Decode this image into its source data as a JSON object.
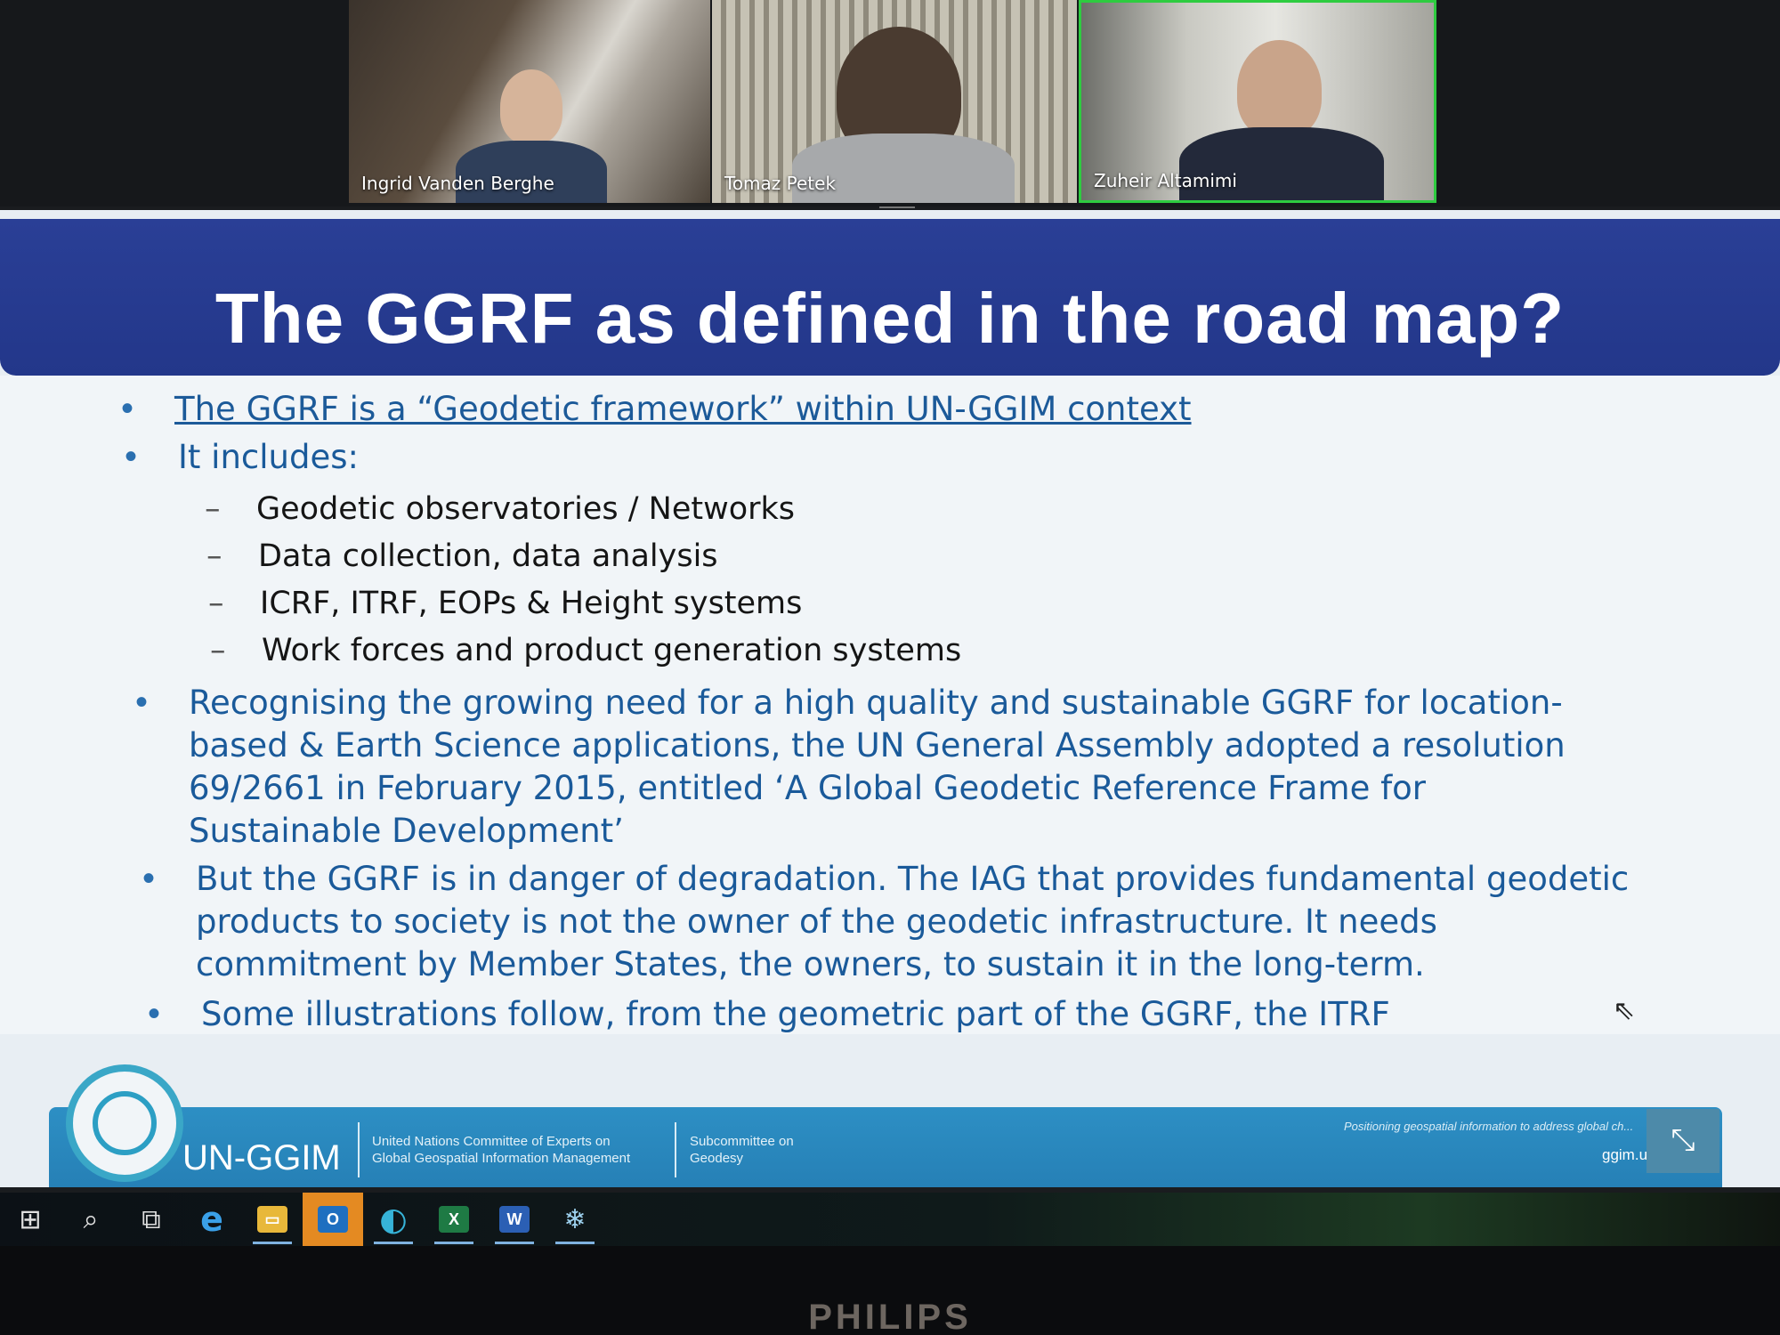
{
  "meeting": {
    "participants": [
      {
        "name": "Ingrid Vanden Berghe",
        "active": false
      },
      {
        "name": "Tomaz Petek",
        "active": false
      },
      {
        "name": "Zuheir Altamimi",
        "active": true
      }
    ]
  },
  "slide": {
    "title": "The GGRF as defined in the road map?",
    "bullets": [
      {
        "text": "The GGRF is a “Geodetic framework” within UN-GGIM context",
        "style": "link"
      },
      {
        "text": "It includes:",
        "style": "plain"
      }
    ],
    "sub_bullets": [
      "Geodetic observatories / Networks",
      "Data collection, data analysis",
      "ICRF, ITRF, EOPs & Height systems",
      "Work forces and product generation systems"
    ],
    "paragraphs": [
      {
        "lines": [
          "Recognising the growing need for a high quality and sustainable GGRF for location-",
          "based & Earth Science applications, the UN General Assembly adopted a resolution",
          "69/2661 in February 2015, entitled ‘A Global Geodetic Reference Frame for",
          "Sustainable Development’"
        ]
      },
      {
        "lines": [
          "But the GGRF is in danger of degradation. The IAG that provides fundamental geodetic",
          "products to society is not the owner of the geodetic infrastructure. It needs",
          "commitment by Member States, the owners, to sustain it in the long-term."
        ]
      },
      {
        "lines": [
          "Some illustrations follow, from the geometric part of the GGRF, the ITRF"
        ]
      }
    ],
    "footer": {
      "logo_text": "UN-GGIM",
      "committee_line1": "United Nations Committee of Experts on",
      "committee_line2": "Global Geospatial Information Management",
      "sub_line1": "Subcommittee on",
      "sub_line2": "Geodesy",
      "tagline": "Positioning geospatial information to address global ch...",
      "url": "ggim.un..."
    },
    "colors": {
      "header": "#23378a",
      "footer": "#2680b6",
      "text_blue": "#1a5a9a"
    }
  },
  "taskbar": {
    "items": [
      {
        "icon": "windows-start-icon",
        "glyph": "⊞"
      },
      {
        "icon": "search-icon",
        "glyph": "⌕"
      },
      {
        "icon": "task-view-icon",
        "glyph": "⧉"
      },
      {
        "icon": "internet-explorer-icon",
        "glyph": "e"
      },
      {
        "icon": "file-explorer-icon",
        "glyph": "▭"
      },
      {
        "icon": "outlook-icon",
        "glyph": "O"
      },
      {
        "icon": "edge-icon",
        "glyph": "◐"
      },
      {
        "icon": "excel-icon",
        "glyph": "X"
      },
      {
        "icon": "word-icon",
        "glyph": "W"
      },
      {
        "icon": "zoom-app-icon",
        "glyph": "❄"
      }
    ]
  },
  "monitor": {
    "brand": "PHILIPS"
  }
}
